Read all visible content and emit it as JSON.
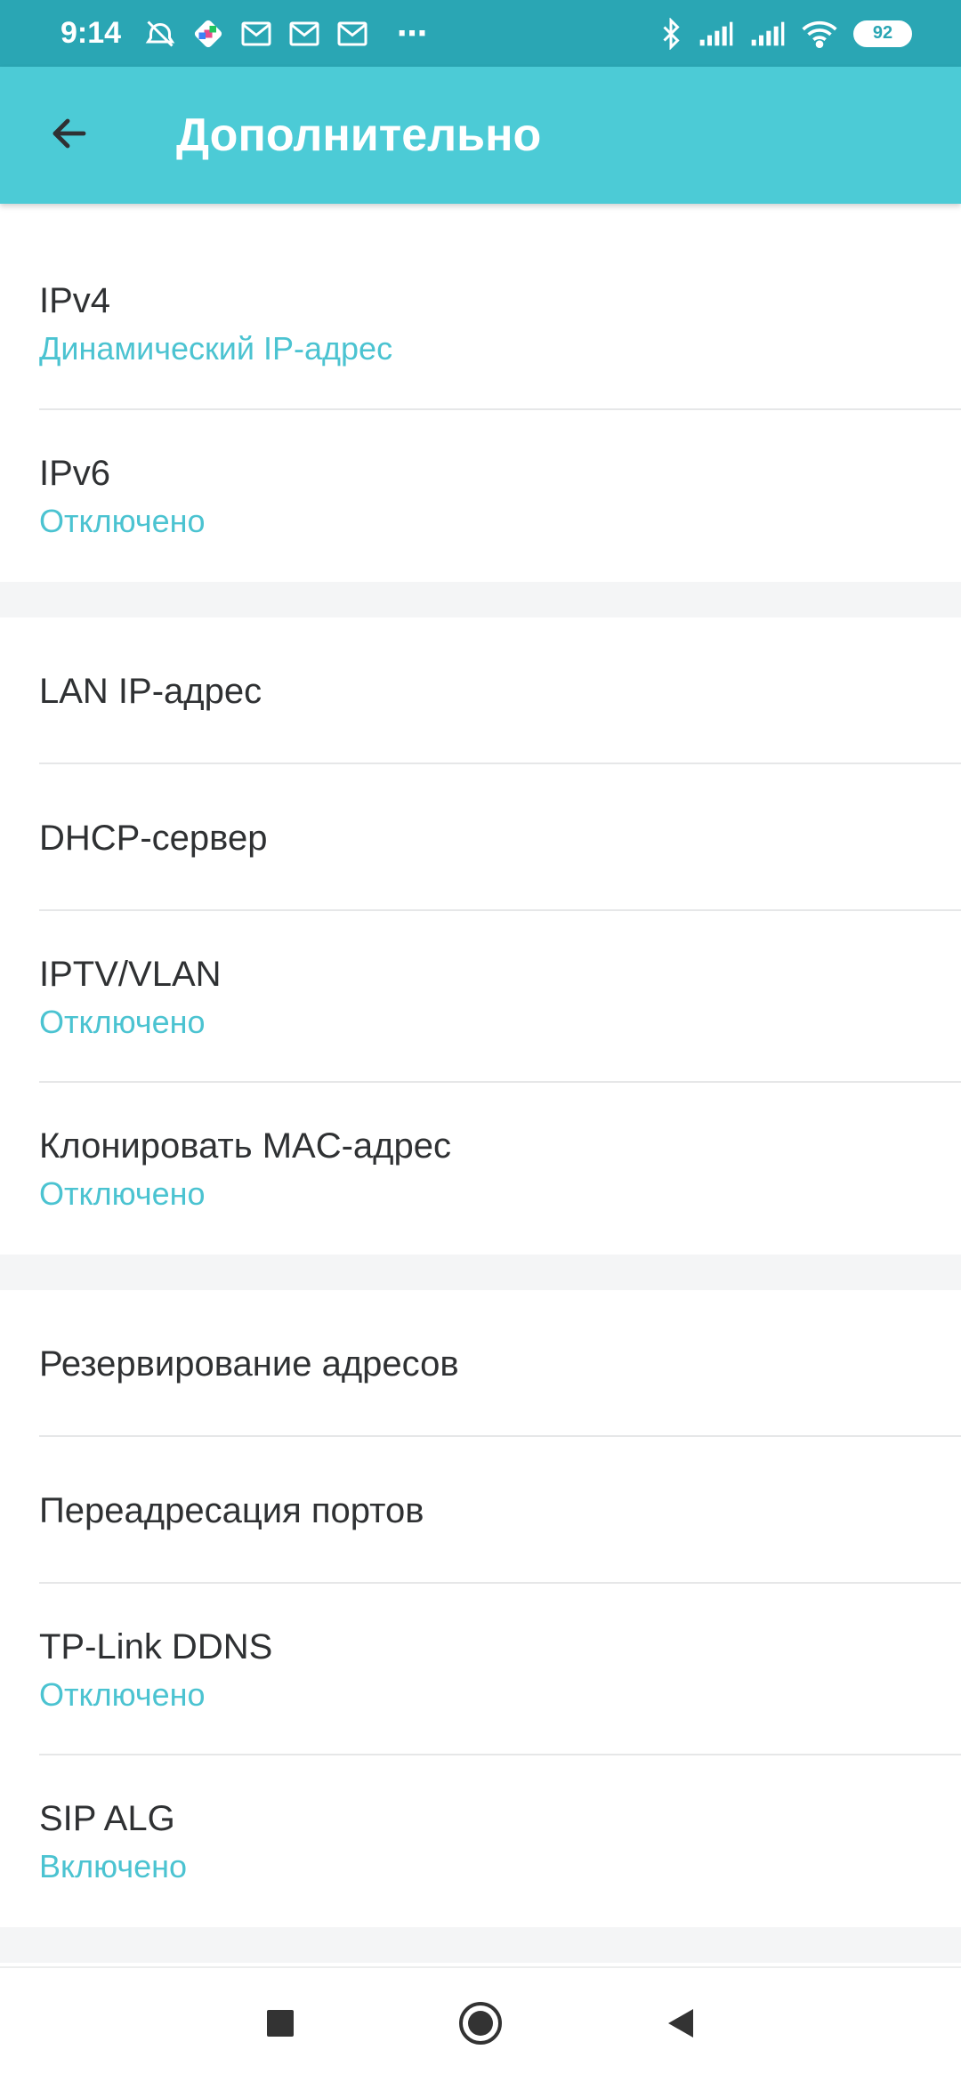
{
  "status_bar": {
    "time": "9:14",
    "battery": "92"
  },
  "app_bar": {
    "title": "Дополнительно"
  },
  "sections": [
    {
      "items": [
        {
          "title": "IPv4",
          "subtitle": "Динамический IP-адрес"
        },
        {
          "title": "IPv6",
          "subtitle": "Отключено"
        }
      ]
    },
    {
      "items": [
        {
          "title": "LAN IP-адрес"
        },
        {
          "title": "DHCP-сервер"
        },
        {
          "title": "IPTV/VLAN",
          "subtitle": "Отключено"
        },
        {
          "title": "Клонировать MAC-адрес",
          "subtitle": "Отключено"
        }
      ]
    },
    {
      "items": [
        {
          "title": "Резервирование адресов"
        },
        {
          "title": "Переадресация портов"
        },
        {
          "title": "TP-Link DDNS",
          "subtitle": "Отключено"
        },
        {
          "title": "SIP ALG",
          "subtitle": "Включено"
        }
      ]
    }
  ],
  "colors": {
    "status_bar": "#2aa6b4",
    "app_bar": "#4ccbd6",
    "accent_text": "#4bc3d1",
    "section_gap": "#f4f5f6"
  },
  "icons": {
    "back": "arrow-left-icon",
    "nav_recents": "square-icon",
    "nav_home": "circle-icon",
    "nav_back": "triangle-left-icon"
  }
}
